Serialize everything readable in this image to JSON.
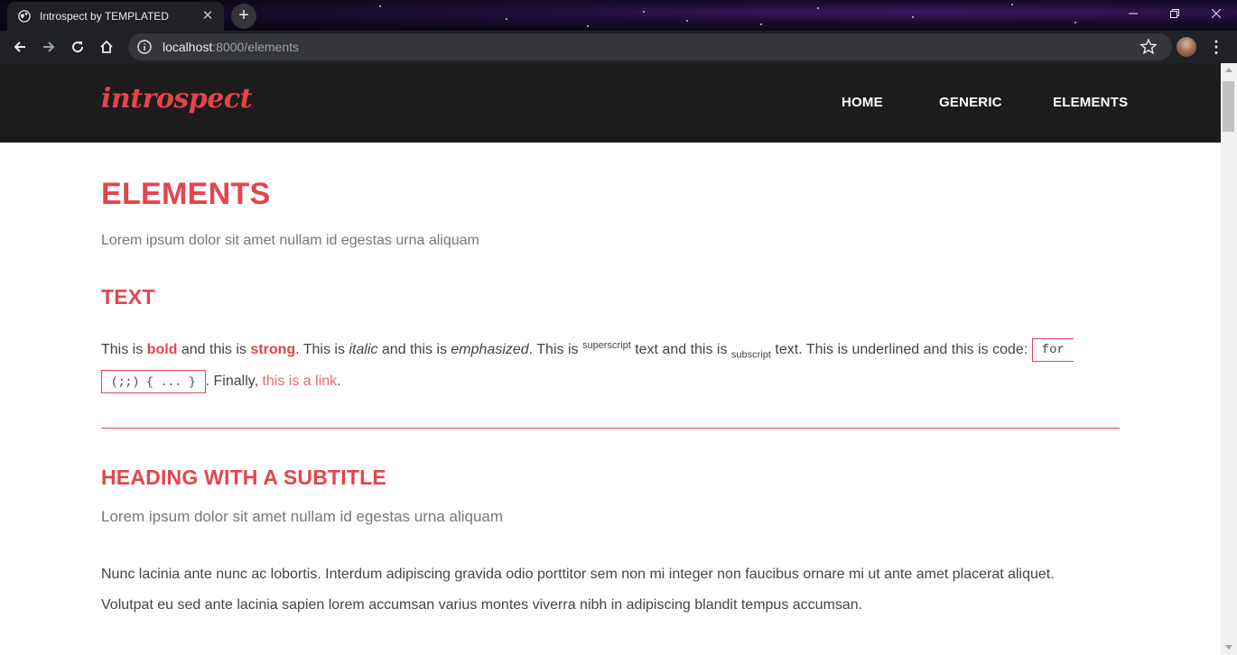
{
  "browser": {
    "tab_title": "Introspect by TEMPLATED",
    "url_host": "localhost",
    "url_path": ":8000/elements"
  },
  "site": {
    "logo": "introspect",
    "nav": [
      "HOME",
      "GENERIC",
      "ELEMENTS"
    ]
  },
  "page": {
    "title": "ELEMENTS",
    "lead": "Lorem ipsum dolor sit amet nullam id egestas urna aliquam",
    "text_section": {
      "heading": "TEXT",
      "p1": "This is ",
      "bold": "bold",
      "p2": " and this is ",
      "strong": "strong",
      "p3": ". This is ",
      "italic": "italic",
      "p4": " and this is ",
      "emphasized": "emphasized",
      "p5": ". This is ",
      "superscript": "superscript",
      "p6": " text and this is ",
      "subscript": "subscript",
      "p7": " text. This is underlined and this is code: ",
      "code_a": "for",
      "code_b": "(;;) { ... }",
      "p8": ". Finally, ",
      "link": "this is a link",
      "p9": "."
    },
    "subtitle_section": {
      "heading": "HEADING WITH A SUBTITLE",
      "subtitle": "Lorem ipsum dolor sit amet nullam id egestas urna aliquam",
      "body_line1": "Nunc lacinia ante nunc ac lobortis. Interdum adipiscing gravida odio porttitor sem non mi integer non faucibus ornare mi ut ante amet placerat aliquet.",
      "body_line2": "Volutpat eu sed ante lacinia sapien lorem accumsan varius montes viverra nibh in adipiscing blandit tempus accumsan."
    }
  },
  "colors": {
    "accent": "#e4444c",
    "header_bg": "#1c1c1c",
    "chrome_bg": "#202124"
  }
}
